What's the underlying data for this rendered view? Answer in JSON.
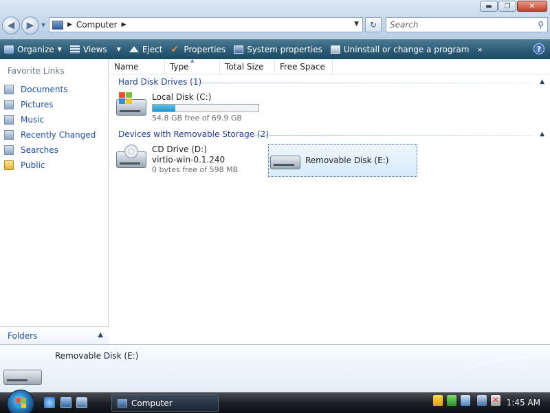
{
  "window": {
    "controls": {
      "minimize": "▬",
      "maximize": "❐",
      "close": "✕"
    }
  },
  "address": {
    "breadcrumb": "Computer",
    "search_placeholder": "Search"
  },
  "toolbar": {
    "items": [
      {
        "label": "Organize",
        "icon": "organize-icon",
        "dropdown": true
      },
      {
        "label": "Views",
        "icon": "views-icon",
        "dropdown": true
      },
      {
        "label": "Eject",
        "icon": "eject-icon"
      },
      {
        "label": "Properties",
        "icon": "properties-icon"
      },
      {
        "label": "System properties",
        "icon": "system-properties-icon"
      },
      {
        "label": "Uninstall or change a program",
        "icon": "uninstall-icon"
      }
    ],
    "overflow": "»",
    "help": "?"
  },
  "sidebar": {
    "title": "Favorite Links",
    "items": [
      {
        "label": "Documents",
        "icon": "documents-icon"
      },
      {
        "label": "Pictures",
        "icon": "pictures-icon"
      },
      {
        "label": "Music",
        "icon": "music-icon"
      },
      {
        "label": "Recently Changed",
        "icon": "recently-changed-icon"
      },
      {
        "label": "Searches",
        "icon": "searches-icon"
      },
      {
        "label": "Public",
        "icon": "public-folder-icon"
      }
    ],
    "folders_label": "Folders"
  },
  "columns": [
    "Name",
    "Type",
    "Total Size",
    "Free Space"
  ],
  "groups": {
    "hdd": {
      "label": "Hard Disk Drives (1)"
    },
    "removable": {
      "label": "Devices with Removable Storage (2)"
    }
  },
  "drives": {
    "c": {
      "name": "Local Disk (C:)",
      "free_text": "54.8 GB free of 69.9 GB",
      "used_fraction": 0.216
    },
    "d": {
      "name": "CD Drive (D:)",
      "label": "virtio-win-0.1.240",
      "free_text": "0 bytes free of 598 MB"
    },
    "e": {
      "name": "Removable Disk (E:)"
    }
  },
  "details": {
    "name": "Removable Disk (E:)"
  },
  "taskbar": {
    "task": "Computer",
    "clock": "1:45 AM"
  },
  "colors": {
    "toolbar": "#2f5f7a",
    "link": "#1f4fa8",
    "group_header": "#1e3d9c",
    "capacity_fill": "#1f95c9"
  }
}
